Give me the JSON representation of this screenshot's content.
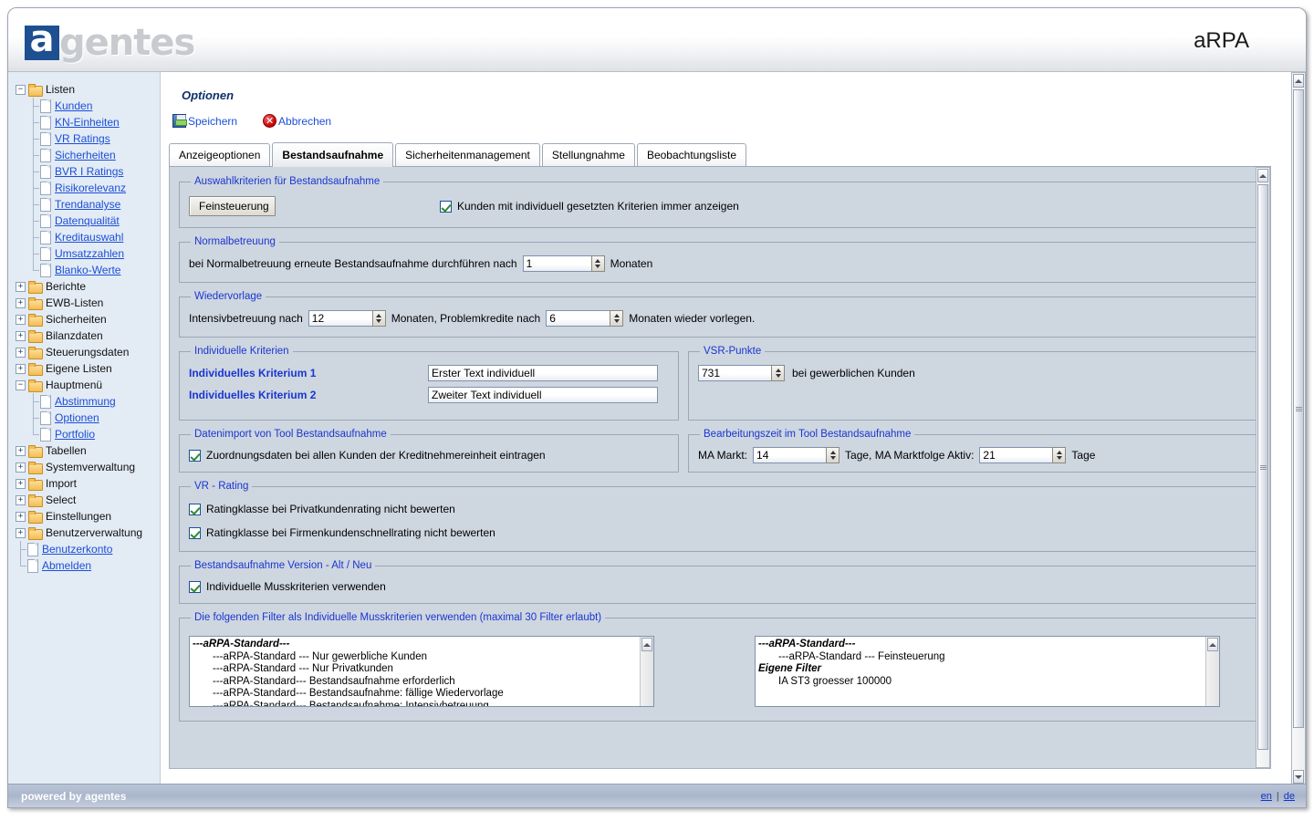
{
  "header": {
    "logo_a": "a",
    "logo_rest": "gentes",
    "app_title": "aRPA"
  },
  "sidebar": {
    "nodes": [
      {
        "type": "folder",
        "toggle": "−",
        "label": "Listen",
        "level": 0
      },
      {
        "type": "file",
        "label": "Kunden",
        "level": 1
      },
      {
        "type": "file",
        "label": "KN-Einheiten",
        "level": 1
      },
      {
        "type": "file",
        "label": "VR Ratings",
        "level": 1
      },
      {
        "type": "file",
        "label": "Sicherheiten",
        "level": 1
      },
      {
        "type": "file",
        "label": "BVR I Ratings",
        "level": 1
      },
      {
        "type": "file",
        "label": "Risikorelevanz",
        "level": 1
      },
      {
        "type": "file",
        "label": "Trendanalyse",
        "level": 1
      },
      {
        "type": "file",
        "label": "Datenqualität",
        "level": 1
      },
      {
        "type": "file",
        "label": "Kreditauswahl",
        "level": 1
      },
      {
        "type": "file",
        "label": "Umsatzzahlen",
        "level": 1
      },
      {
        "type": "file",
        "label": "Blanko-Werte",
        "level": 1,
        "last": true
      },
      {
        "type": "folder",
        "toggle": "+",
        "label": "Berichte",
        "level": 0
      },
      {
        "type": "folder",
        "toggle": "+",
        "label": "EWB-Listen",
        "level": 0
      },
      {
        "type": "folder",
        "toggle": "+",
        "label": "Sicherheiten",
        "level": 0
      },
      {
        "type": "folder",
        "toggle": "+",
        "label": "Bilanzdaten",
        "level": 0
      },
      {
        "type": "folder",
        "toggle": "+",
        "label": "Steuerungsdaten",
        "level": 0
      },
      {
        "type": "folder",
        "toggle": "+",
        "label": "Eigene Listen",
        "level": 0
      },
      {
        "type": "folder",
        "toggle": "−",
        "label": "Hauptmenü",
        "level": 0
      },
      {
        "type": "file",
        "label": "Abstimmung",
        "level": 1
      },
      {
        "type": "file",
        "label": "Optionen",
        "level": 1
      },
      {
        "type": "file",
        "label": "Portfolio",
        "level": 1,
        "last": true
      },
      {
        "type": "folder",
        "toggle": "+",
        "label": "Tabellen",
        "level": 0
      },
      {
        "type": "folder",
        "toggle": "+",
        "label": "Systemverwaltung",
        "level": 0
      },
      {
        "type": "folder",
        "toggle": "+",
        "label": "Import",
        "level": 0
      },
      {
        "type": "folder",
        "toggle": "+",
        "label": "Select",
        "level": 0
      },
      {
        "type": "folder",
        "toggle": "+",
        "label": "Einstellungen",
        "level": 0
      },
      {
        "type": "folder",
        "toggle": "+",
        "label": "Benutzerverwaltung",
        "level": 0
      },
      {
        "type": "file",
        "label": "Benutzerkonto",
        "level": 0
      },
      {
        "type": "file",
        "label": "Abmelden",
        "level": 0,
        "last": true
      }
    ]
  },
  "main": {
    "page_title": "Optionen",
    "actions": {
      "save": "Speichern",
      "cancel": "Abbrechen"
    },
    "tabs": [
      {
        "label": "Anzeigeoptionen",
        "active": false
      },
      {
        "label": "Bestandsaufnahme",
        "active": true
      },
      {
        "label": "Sicherheitenmanagement",
        "active": false
      },
      {
        "label": "Stellungnahme",
        "active": false
      },
      {
        "label": "Beobachtungsliste",
        "active": false
      }
    ],
    "auswahlkriterien": {
      "legend": "Auswahlkriterien für Bestandsaufnahme",
      "feinsteuerung_button": "Feinsteuerung",
      "checkbox_label": "Kunden mit individuell gesetzten Kriterien immer anzeigen",
      "checkbox_checked": true
    },
    "normalbetreuung": {
      "legend": "Normalbetreuung",
      "prefix": "bei Normalbetreuung erneute Bestandsaufnahme durchführen nach",
      "value": "1",
      "suffix": "Monaten"
    },
    "wiedervorlage": {
      "legend": "Wiedervorlage",
      "label1": "Intensivbetreuung nach",
      "value1": "12",
      "label2": "Monaten, Problemkredite nach",
      "value2": "6",
      "label3": "Monaten wieder vorlegen."
    },
    "individuelle_kriterien": {
      "legend": "Individuelle Kriterien",
      "rows": [
        {
          "label": "Individuelles Kriterium 1",
          "value": "Erster Text individuell"
        },
        {
          "label": "Individuelles Kriterium 2",
          "value": "Zweiter Text individuell"
        }
      ]
    },
    "vsr_punkte": {
      "legend": "VSR-Punkte",
      "value": "731",
      "suffix": "bei gewerblichen Kunden"
    },
    "datenimport": {
      "legend": "Datenimport von Tool Bestandsaufnahme",
      "checkbox_label": "Zuordnungsdaten bei allen Kunden der Kreditnehmereinheit eintragen",
      "checkbox_checked": true
    },
    "bearbeitungszeit": {
      "legend": "Bearbeitungszeit im Tool Bestandsaufnahme",
      "label1": "MA Markt:",
      "value1": "14",
      "label2": "Tage, MA Marktfolge Aktiv:",
      "value2": "21",
      "label3": "Tage"
    },
    "vr_rating": {
      "legend": "VR - Rating",
      "items": [
        {
          "label": "Ratingklasse bei Privatkundenrating nicht bewerten",
          "checked": true
        },
        {
          "label": "Ratingklasse bei Firmenkundenschnellrating nicht bewerten",
          "checked": true
        }
      ]
    },
    "version": {
      "legend": "Bestandsaufnahme Version - Alt / Neu",
      "checkbox_label": "Individuelle Musskriterien verwenden",
      "checkbox_checked": true
    },
    "filter": {
      "legend": "Die folgenden Filter als Individuelle Musskriterien verwenden (maximal 30 Filter erlaubt)",
      "available": [
        {
          "text": "---aRPA-Standard---",
          "header": true
        },
        {
          "text": "---aRPA-Standard --- Nur gewerbliche Kunden",
          "header": false
        },
        {
          "text": "---aRPA-Standard --- Nur Privatkunden",
          "header": false
        },
        {
          "text": "---aRPA-Standard--- Bestandsaufnahme erforderlich",
          "header": false
        },
        {
          "text": "---aRPA-Standard--- Bestandsaufnahme: fällige Wiedervorlage",
          "header": false
        },
        {
          "text": "---aRPA-Standard--- Bestandsaufnahme: Intensivbetreuung",
          "header": false
        }
      ],
      "selected": [
        {
          "text": "---aRPA-Standard---",
          "header": true
        },
        {
          "text": "---aRPA-Standard --- Feinsteuerung",
          "header": false
        },
        {
          "text": "Eigene Filter",
          "header": true
        },
        {
          "text": "IA ST3 groesser 100000",
          "header": false
        }
      ]
    }
  },
  "footer": {
    "powered": "powered by agentes",
    "lang_en": "en",
    "lang_sep": "|",
    "lang_de": "de"
  }
}
